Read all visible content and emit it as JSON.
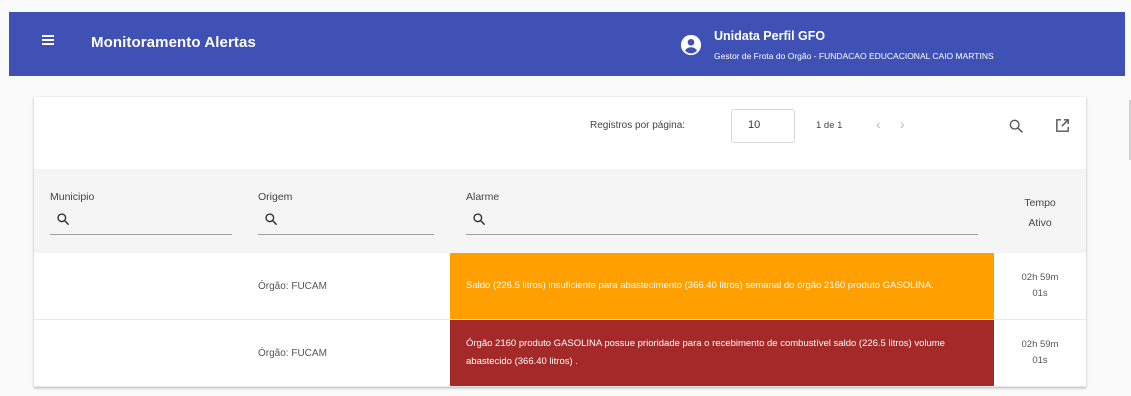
{
  "topbar": {
    "app_title": "Monitoramento Alertas",
    "user_name": "Unidata Perfil GFO",
    "user_role": "Gestor de Frota do Orgão - FUNDACAO EDUCACIONAL CAIO MARTINS",
    "color": "#3f51b5"
  },
  "toolbar": {
    "per_page_label": "Registros por página:",
    "per_page_value": "10",
    "range": "1 de 1",
    "prev": "‹",
    "next": "›"
  },
  "table": {
    "columns": {
      "municipio": "Municipio",
      "origem": "Origem",
      "alarme": "Alarme",
      "tempo_line1": "Tempo",
      "tempo_line2": "Ativo"
    },
    "rows": [
      {
        "municipio": "",
        "origem": "Órgão: FUCAM",
        "alarme": "Saldo (226.5 litros) insuficiente para abastecimento (366.40 litros) semanal do órgão 2160 produto GASOLINA.",
        "alarm_color": "#ffa000",
        "tempo_line1": "02h 59m",
        "tempo_line2": "01s"
      },
      {
        "municipio": "",
        "origem": "Órgão: FUCAM",
        "alarme": "Órgão 2160 produto GASOLINA possue prioridade para o recebimento de combustível saldo (226.5 litros) volume abastecido (366.40 litros) .",
        "alarm_color": "#a42a2a",
        "tempo_line1": "02h 59m",
        "tempo_line2": "01s"
      }
    ]
  }
}
